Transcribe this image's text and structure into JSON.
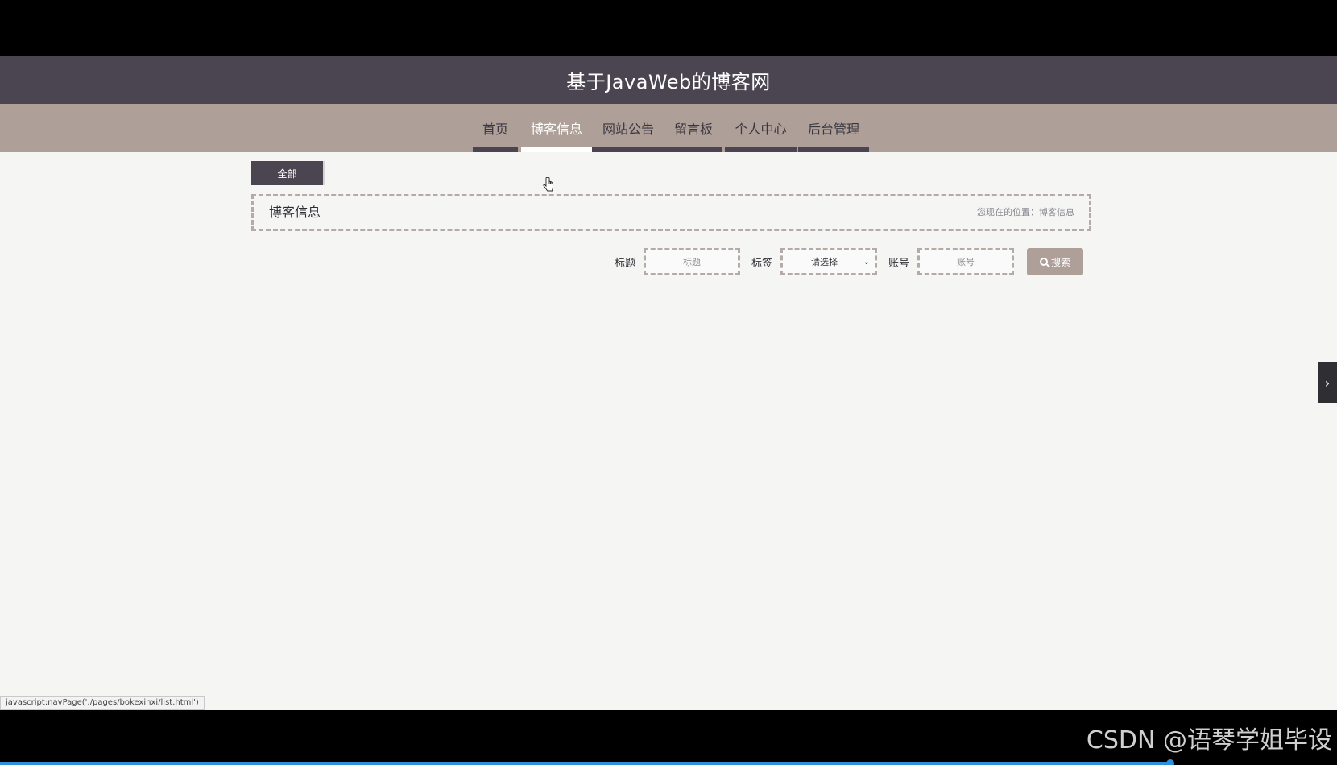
{
  "header": {
    "title": "基于JavaWeb的博客网"
  },
  "nav": {
    "items": [
      {
        "label": "首页"
      },
      {
        "label": "博客信息"
      },
      {
        "label": "网站公告"
      },
      {
        "label": "留言板"
      },
      {
        "label": "个人中心"
      },
      {
        "label": "后台管理"
      }
    ],
    "active_label": "博客信息"
  },
  "tabs": {
    "all": "全部"
  },
  "section": {
    "title": "博客信息",
    "breadcrumb": "您现在的位置：博客信息"
  },
  "search": {
    "title_label": "标题",
    "title_placeholder": "标题",
    "tag_label": "标签",
    "tag_value": "请选择",
    "account_label": "账号",
    "account_placeholder": "账号",
    "search_label": "搜索"
  },
  "status": {
    "link_text": "javascript:navPage('./pages/bokexinxi/list.html')"
  },
  "video": {
    "watermark": "CSDN @语琴学姐毕设",
    "progress": 0.875
  },
  "colors": {
    "header": "#4a4550",
    "nav": "#ae9f98",
    "page": "#f5f5f4",
    "accent": "#2e8fdb"
  }
}
